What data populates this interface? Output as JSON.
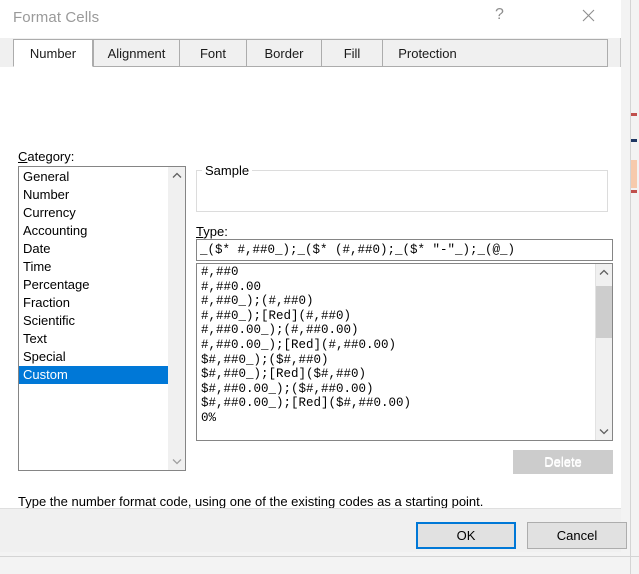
{
  "window": {
    "title": "Format Cells",
    "help_button": "?",
    "close_button": "✕"
  },
  "tabs": [
    {
      "label": "Number",
      "active": true
    },
    {
      "label": "Alignment",
      "active": false
    },
    {
      "label": "Font",
      "active": false
    },
    {
      "label": "Border",
      "active": false
    },
    {
      "label": "Fill",
      "active": false
    },
    {
      "label": "Protection",
      "active": false
    }
  ],
  "category": {
    "label": "Category:",
    "accelerator": "C",
    "items": [
      "General",
      "Number",
      "Currency",
      "Accounting",
      "Date",
      "Time",
      "Percentage",
      "Fraction",
      "Scientific",
      "Text",
      "Special",
      "Custom"
    ],
    "selected": "Custom"
  },
  "sample": {
    "legend": "Sample",
    "value": ""
  },
  "type": {
    "label": "Type:",
    "accelerator": "T",
    "value": "_($* #,##0_);_($* (#,##0);_($* \"-\"_);_(@_)",
    "placeholder": "",
    "items": [
      "#,##0",
      "#,##0.00",
      "#,##0_);(#,##0)",
      "#,##0_);[Red](#,##0)",
      "#,##0.00_);(#,##0.00)",
      "#,##0.00_);[Red](#,##0.00)",
      "$#,##0_);($#,##0)",
      "$#,##0_);[Red]($#,##0)",
      "$#,##0.00_);($#,##0.00)",
      "$#,##0.00_);[Red]($#,##0.00)",
      "0%"
    ]
  },
  "delete_button": {
    "label": "Delete",
    "enabled": false
  },
  "help_text": "Type the number format code, using one of the existing codes as a starting point.",
  "footer": {
    "ok_label": "OK",
    "cancel_label": "Cancel"
  },
  "colors": {
    "selection": "#0078d7",
    "focus_border": "#0078d7",
    "dialog_bg": "#f0f0f0",
    "panel_bg": "#ffffff",
    "title_text": "#9a9a9a"
  }
}
